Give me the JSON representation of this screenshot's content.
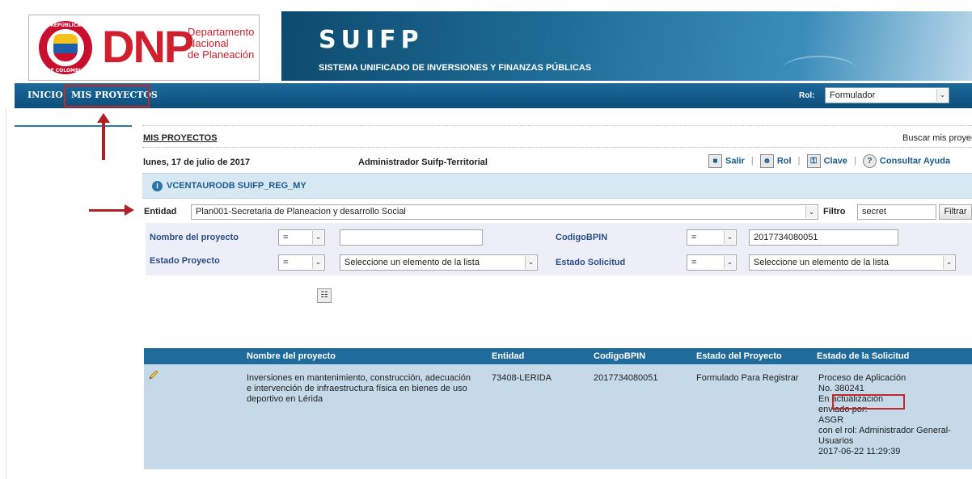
{
  "header": {
    "seal_top": "REPÚBLICA",
    "seal_bottom": "DE COLOMBIA",
    "logo_letters": "DNP",
    "logo_line1": "Departamento",
    "logo_line2": "Nacional",
    "logo_line3": "de Planeación",
    "app_title": "SUIFP",
    "app_subtitle": "SISTEMA UNIFICADO DE INVERSIONES Y FINANZAS PÚBLICAS"
  },
  "nav": {
    "items": [
      {
        "label": "INICIO"
      },
      {
        "label": "MIS PROYECTOS"
      }
    ],
    "rol_label": "Rol:",
    "rol_value": "Formulador"
  },
  "page": {
    "title": "MIS PROYECTOS",
    "search_link": "Buscar mis proyect",
    "date": "lunes, 17 de julio de 2017",
    "user": "Administrador Suifp-Territorial"
  },
  "toolbar": {
    "salir": "Salir",
    "rol": "Rol",
    "clave": "Clave",
    "ayuda": "Consultar Ayuda"
  },
  "info": {
    "text": "VCENTAURODB SUIFP_REG_MY"
  },
  "entity": {
    "label": "Entidad",
    "value": "Plan001-Secretaria de Planeacion y desarrollo Social",
    "filter_label": "Filtro",
    "filter_value": "secret",
    "filter_button": "Filtrar"
  },
  "filters": {
    "nombre_label": "Nombre del proyecto",
    "nombre_op": "=",
    "nombre_value": "",
    "codigo_label": "CodigoBPIN",
    "codigo_op": "=",
    "codigo_value": "2017734080051",
    "estado_label": "Estado Proyecto",
    "estado_op": "=",
    "estado_value": "Seleccione un elemento de la lista",
    "solicitud_label": "Estado Solicitud",
    "solicitud_op": "=",
    "solicitud_value": "Seleccione un elemento de la lista"
  },
  "table": {
    "columns": [
      "Nombre del proyecto",
      "Entidad",
      "CodigoBPIN",
      "Estado del Proyecto",
      "Estado de la Solicitud"
    ],
    "rows": [
      {
        "nombre": "Inversiones en mantenimiento, construcción, adecuación e intervención de infraestructura física en bienes de uso deportivo en Lérida",
        "entidad": "73408-LERIDA",
        "codigo": "2017734080051",
        "estado": "Formulado Para Registrar",
        "solicitud_lines": [
          "Proceso de Aplicación",
          "No. 380241",
          "En actualización",
          "enviado por:",
          "ASGR",
          "con el rol: Administrador General-",
          "Usuarios",
          "2017-06-22 11:29:39"
        ]
      }
    ]
  },
  "colors": {
    "nav_bg": "#0d4e7b",
    "table_head": "#1f6b9b",
    "row_bg": "#c5d9e8",
    "highlight": "#c0282b",
    "brand_red": "#d01f2e"
  }
}
